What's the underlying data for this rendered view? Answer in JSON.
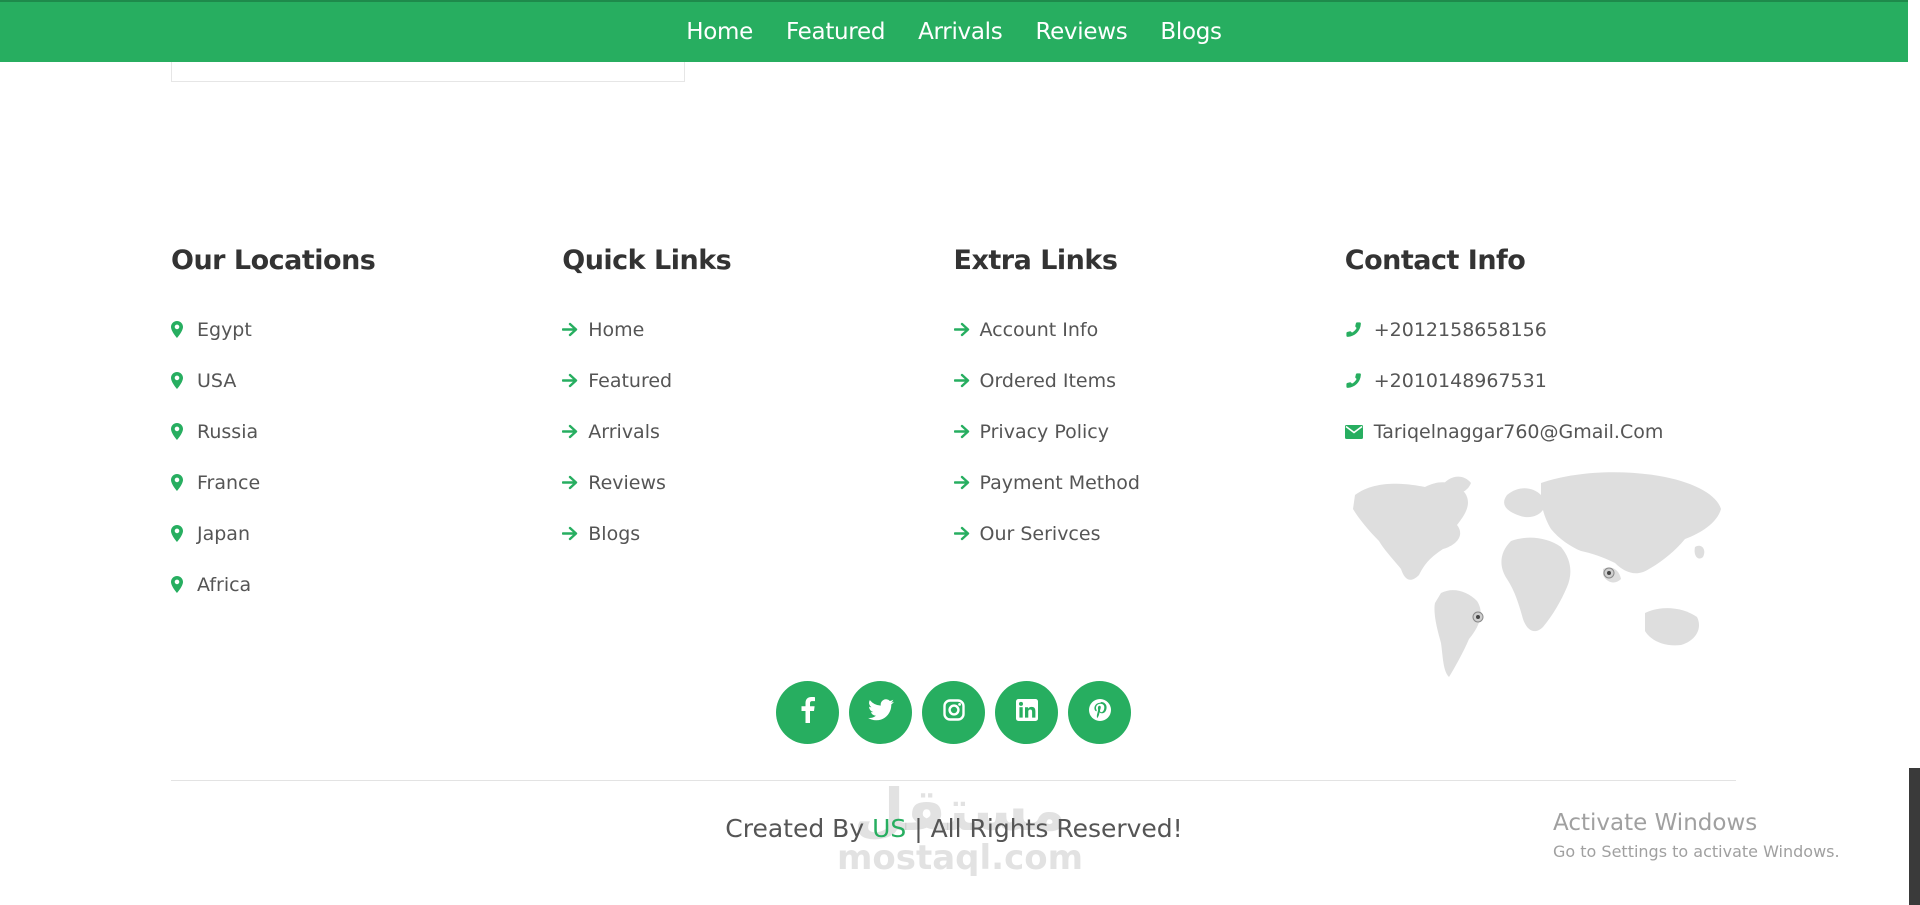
{
  "nav": {
    "items": [
      "Home",
      "Featured",
      "Arrivals",
      "Reviews",
      "Blogs"
    ]
  },
  "footer": {
    "locations": {
      "title": "Our Locations",
      "items": [
        "Egypt",
        "USA",
        "Russia",
        "France",
        "Japan",
        "Africa"
      ]
    },
    "quick_links": {
      "title": "Quick Links",
      "items": [
        "Home",
        "Featured",
        "Arrivals",
        "Reviews",
        "Blogs"
      ]
    },
    "extra_links": {
      "title": "Extra Links",
      "items": [
        "Account Info",
        "Ordered Items",
        "Privacy Policy",
        "Payment Method",
        "Our Serivces"
      ]
    },
    "contact": {
      "title": "Contact Info",
      "phone1": "+2012158658156",
      "phone2": "+2010148967531",
      "email": "Tariqelnaggar760@Gmail.Com"
    }
  },
  "socials": [
    "facebook-icon",
    "twitter-icon",
    "instagram-icon",
    "linkedin-icon",
    "pinterest-icon"
  ],
  "credit": {
    "prefix": "Created By",
    "brand": "US",
    "suffix": "| All Rights Reserved!"
  },
  "watermark": {
    "arabic": "مستقل",
    "latin": "mostaql.com"
  },
  "os_notice": {
    "title": "Activate Windows",
    "subtitle": "Go to Settings to activate Windows."
  },
  "colors": {
    "accent": "#27ae60",
    "heading": "#333333",
    "text": "#555555"
  }
}
